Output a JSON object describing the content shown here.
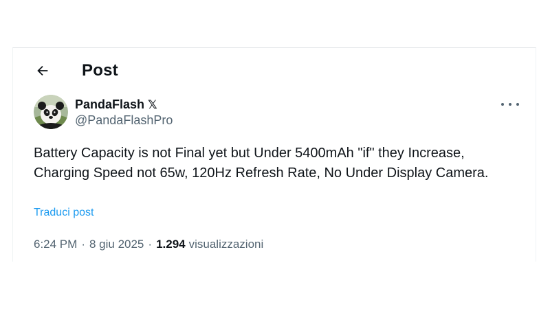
{
  "header": {
    "back_icon": "arrow-left-icon",
    "title": "Post"
  },
  "author": {
    "display_name": "PandaFlash",
    "badge": "𝕏",
    "handle": "@PandaFlashPro",
    "avatar_icon": "panda-avatar"
  },
  "more_icon": "more-horizontal-icon",
  "post": {
    "text": "Battery Capacity is not Final yet but Under 5400mAh \"if\" they Increase, Charging Speed not 65w, 120Hz Refresh Rate, No Under Display Camera.",
    "translate_label": "Traduci post"
  },
  "meta": {
    "time": "6:24 PM",
    "separator": "·",
    "date": "8 giu 2025",
    "views_count": "1.294",
    "views_label": "visualizzazioni"
  },
  "colors": {
    "text": "#0f1419",
    "secondary": "#536471",
    "link": "#1d9bf0",
    "border": "#e1e4e8"
  }
}
